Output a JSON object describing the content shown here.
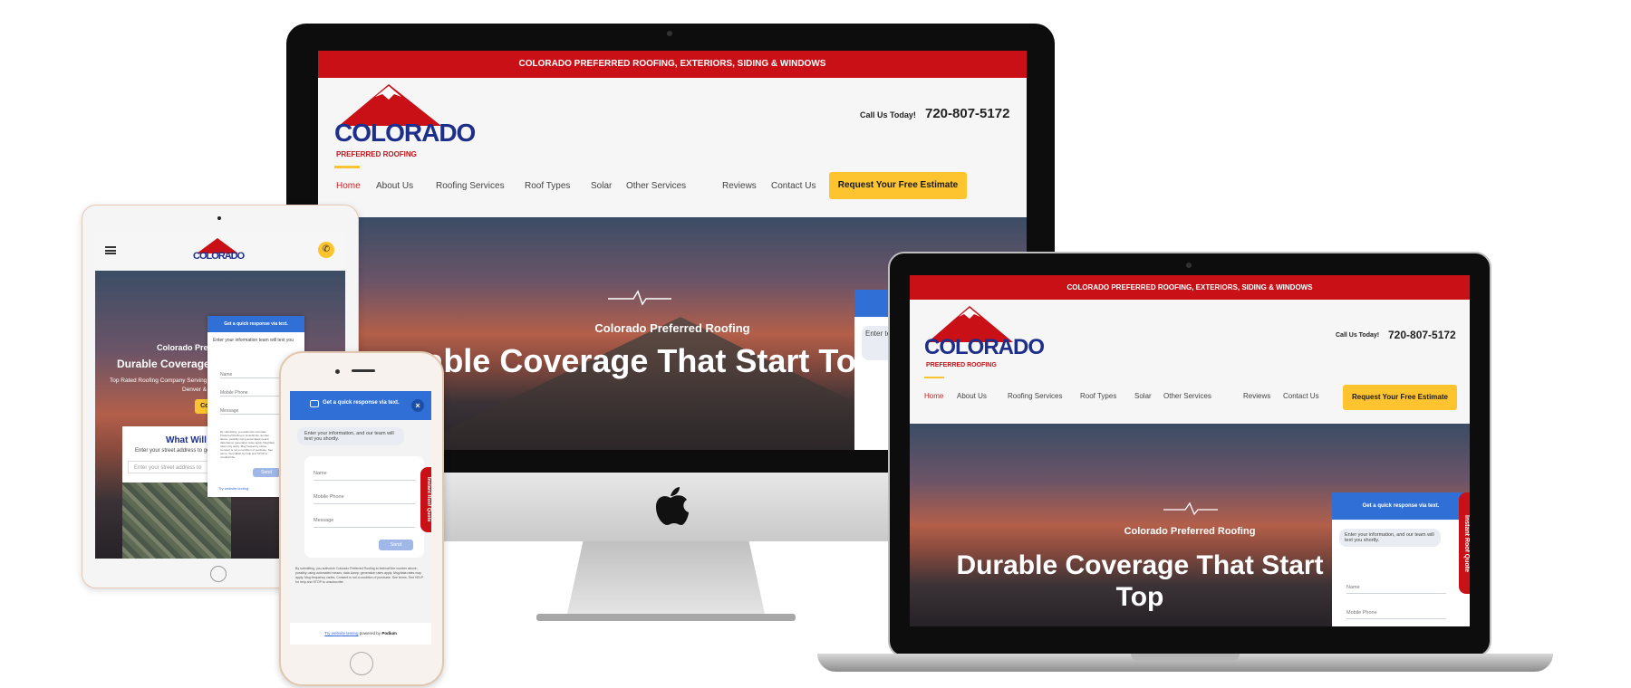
{
  "site": {
    "top_banner": "COLORADO PREFERRED ROOFING, EXTERIORS, SIDING & WINDOWS",
    "logo_word": "COLORADO",
    "logo_sub": "PREFERRED ROOFING",
    "call_label": "Call Us Today!",
    "phone": "720-807-5172",
    "nav": [
      "Home",
      "About Us",
      "Roofing Services",
      "Roof Types",
      "Solar",
      "Other Services",
      "Reviews",
      "Contact Us"
    ],
    "cta": "Request Your Free Estimate",
    "hero_subtitle": "Colorado Preferred Roofing",
    "hero_title": "Durable Coverage That Starts From The Top",
    "desktop_hero_title_visible": "rable Coverage That Start Top",
    "tablet_hero_title_visible": "Durable Coverage Tha",
    "tablet_hero_subtitle_visible": "Colorado Prefer",
    "tablet_hero_body": "Top Rated Roofing Company Serving Littl",
    "tablet_hero_body2": "Denver & Beyo",
    "tablet_contact_btn": "Contac",
    "tablet_card_title": "What Will My",
    "tablet_card_text": "Enter your street address to get",
    "tablet_address_placeholder": "Enter your street address to",
    "laptop_hero_title": "Durable Coverage That Start Top"
  },
  "chat": {
    "header": "Get a quick response via text.",
    "intro": "Enter your information, and our team will text you shortly.",
    "name_placeholder": "Name",
    "phone_placeholder": "Mobile Phone",
    "message_placeholder": "Message",
    "send": "Send",
    "disclaimer": "By submitting, you authorize Colorado Preferred Roofing to text/call the number above, possibly using automated means; data &amp; generation rates apply. Msg/data rates may apply. Msg frequency varies. Consent is not a condition of purchase. See terms. Text HELP for help and STOP to unsubscribe.",
    "footer_link": "Try website texting",
    "footer_powered": "powered by",
    "footer_brand": "Podium",
    "quote_tab": "Instant Roof Quote",
    "tablet_intro_partial": "Enter your information team will text you",
    "tablet_name": "Name",
    "tablet_phone": "Mobile Phone",
    "tablet_msg": "Message",
    "tablet_footer": "Try website texting",
    "desktop_intro_partial": "Enter team",
    "laptop_name": "Name",
    "laptop_phone": "Mobile Phone"
  },
  "colors": {
    "brand_red": "#c91017",
    "brand_blue": "#1d2f8a",
    "cta_yellow": "#fdc42f",
    "chat_blue": "#2f6fd6"
  }
}
